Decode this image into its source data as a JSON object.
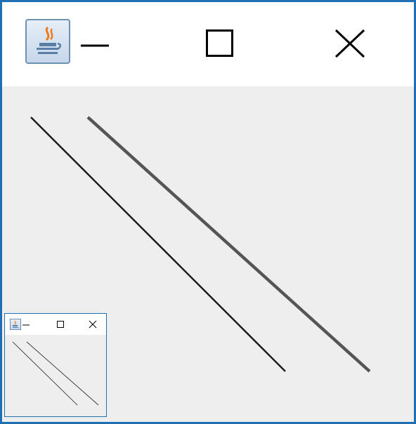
{
  "window": {
    "title": "",
    "icon": "java-cup-icon",
    "controls": [
      "minimize-icon",
      "maximize-icon",
      "close-icon"
    ],
    "border_color": "#1f6fb4",
    "client_background": "#eeeeee"
  },
  "canvas": {
    "lines": [
      {
        "name": "thin-diagonal-line",
        "color": "#1a1a1a"
      },
      {
        "name": "thick-diagonal-line",
        "color": "#555555"
      }
    ]
  },
  "thumbnail": {
    "icon": "java-cup-icon",
    "controls": [
      "minimize-icon",
      "maximize-icon",
      "close-icon"
    ]
  }
}
